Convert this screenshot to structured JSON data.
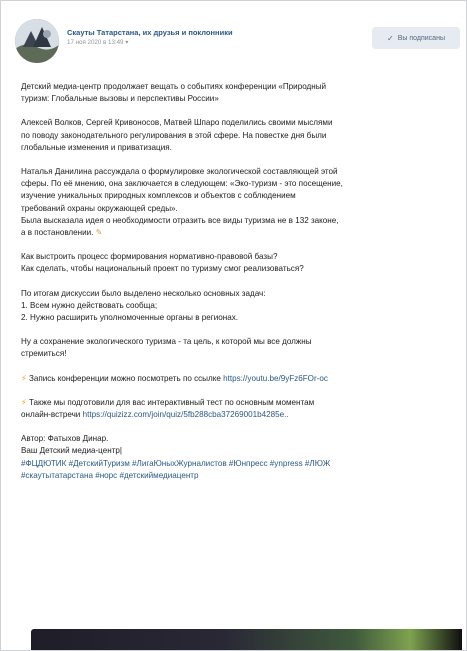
{
  "post": {
    "author": "Скауты Татарстана, их друзья и поклонники",
    "date": "17 ноя 2020 в 13:49",
    "subscribed_label": "Вы подписаны",
    "paragraphs": [
      {
        "lines": [
          "Детский медиа-центр продолжает вещать о событиях конференции «Природный",
          "туризм: Глобальные вызовы и перспективы России»"
        ]
      },
      {
        "lines": [
          "Алексей Волков, Сергей Кривоносов, Матвей Шпаро поделились своими мыслями",
          "по поводу законодательного регулирования в этой сфере. На повестке дня были",
          "глобальные изменения и приватизация."
        ]
      },
      {
        "lines": [
          "Наталья Данилина рассуждала о формулировке экологической составляющей этой",
          "сферы. По её мнению, она заключается в следующем: «Эко-туризм - это посещение,",
          "изучение уникальных природных комплексов и объектов с соблюдением",
          "требований охраны окружающей среды».",
          "Была высказала идея о необходимости отразить все виды туризма не в 132 законе,",
          "а в постановлении."
        ]
      },
      {
        "lines": [
          "Как выстроить процесс формирования нормативно-правовой базы?",
          "Как сделать, чтобы национальный проект по туризму смог реализоваться?"
        ]
      },
      {
        "lines": [
          "По итогам дискуссии было выделено несколько основных задач:",
          "1. Всем нужно действовать сообща;",
          "2. Нужно расширить уполномоченные органы в регионах."
        ]
      },
      {
        "lines": [
          "Ну а сохранение экологического туризма - та цель, к которой мы все должны",
          "стремиться!"
        ]
      }
    ],
    "record_text": "Запись конференции можно посмотреть по ссылке",
    "record_link": "https://youtu.be/9yFz6FOr-oc",
    "test_text_1": "Также мы подготовили для вас интерактивный тест по основным моментам",
    "test_text_2": "онлайн-встречи",
    "test_link": "https://quizizz.com/join/quiz/5fb288cba37269001b4285e..",
    "author_line": "Автор: Фатыхов Динар.",
    "center_line": "Ваш Детский медиа-центр|",
    "hashtags_1": "#ФЦДЮТИК #ДетскийТуризм #ЛигаЮныхЖурналистов #Юнпресс #ynpress #ЛЮЖ",
    "hashtags_2": "#скаутытатарстана #норс #детскиймедиацентр"
  },
  "colors": {
    "link": "#2a5885",
    "subscribe_bg": "#e5ebf1",
    "background": "#edeef0"
  },
  "icons": [
    "avatar-image",
    "check-icon",
    "lightning-icon",
    "pencil-icon"
  ]
}
